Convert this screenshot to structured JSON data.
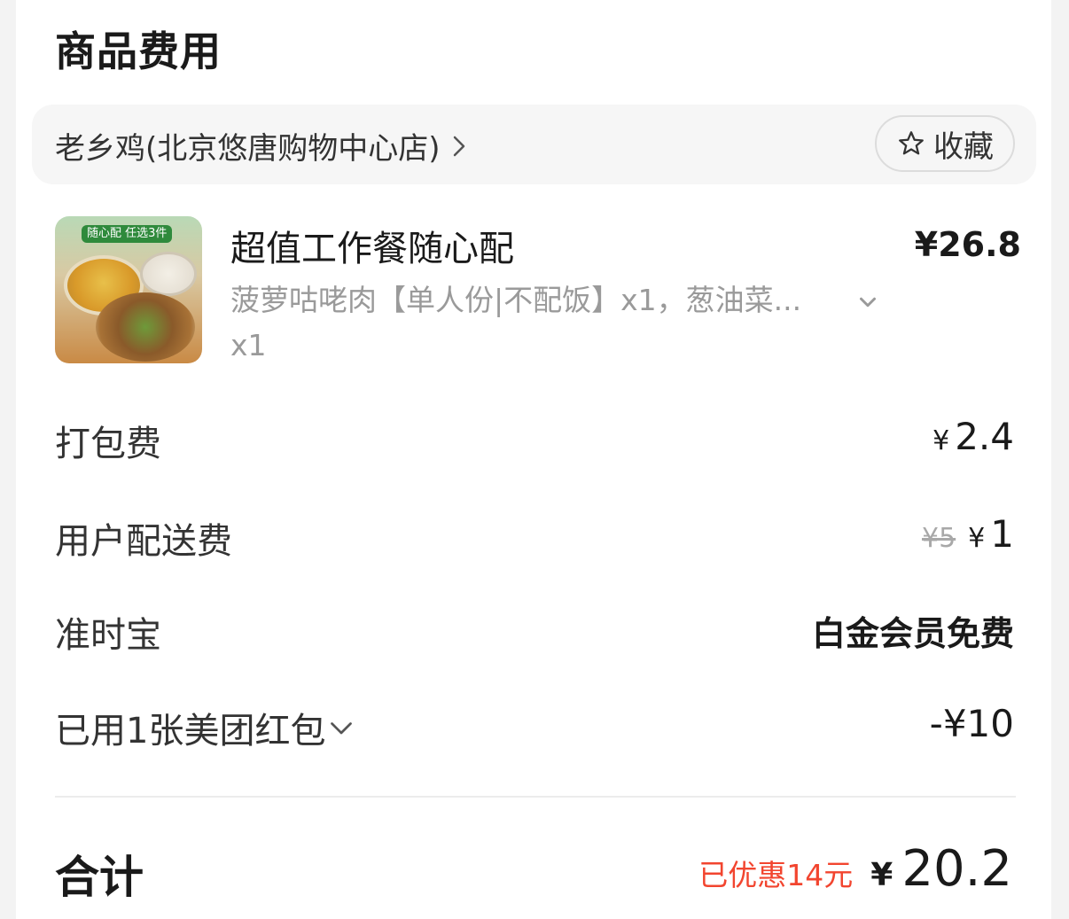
{
  "section": {
    "title": "商品费用"
  },
  "shop": {
    "name": "老乡鸡(北京悠唐购物中心店)",
    "favorite_label": "收藏"
  },
  "product": {
    "image_badge": "随心配 任选3件",
    "name": "超值工作餐随心配",
    "price": "¥26.8",
    "desc": "菠萝咕咾肉【单人份|不配饭】x1，葱油菜...",
    "qty": "x1"
  },
  "fees": {
    "packing": {
      "label": "打包费",
      "currency": "¥",
      "amount": "2.4"
    },
    "delivery": {
      "label": "用户配送费",
      "original": "¥5",
      "currency": "¥",
      "amount": "1"
    },
    "ontime": {
      "label": "准时宝",
      "value": "白金会员免费"
    },
    "coupon": {
      "label": "已用1张美团红包",
      "value": "-¥10"
    }
  },
  "total": {
    "label": "合计",
    "saved": "已优惠14元",
    "currency": "¥",
    "amount": "20.2"
  },
  "colors": {
    "accent_red": "#f2452f",
    "text_dark": "#1a1a1a",
    "text_muted": "#9a9a9a"
  },
  "icons": {
    "shop_chevron": "chevron-right-icon",
    "favorite": "star-icon",
    "expand": "chevron-down-icon"
  }
}
